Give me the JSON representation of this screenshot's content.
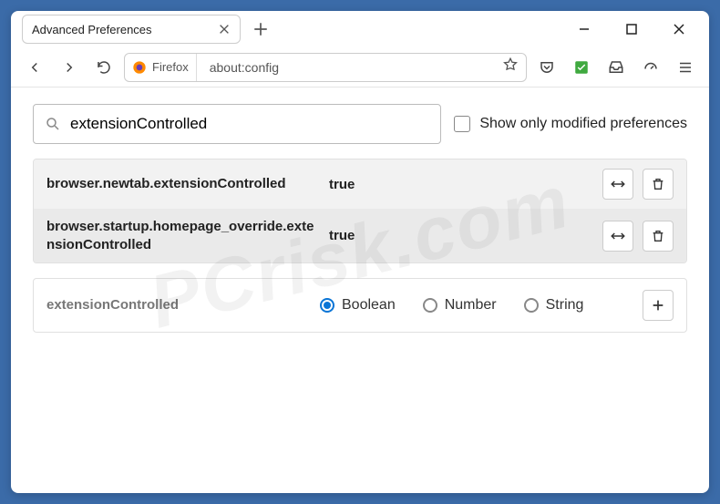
{
  "window": {
    "tab_title": "Advanced Preferences"
  },
  "urlbar": {
    "identity_label": "Firefox",
    "url": "about:config"
  },
  "config": {
    "search_value": "extensionControlled",
    "modified_only_label": "Show only modified preferences",
    "modified_only_checked": false
  },
  "prefs": [
    {
      "name": "browser.newtab.extensionControlled",
      "value": "true"
    },
    {
      "name": "browser.startup.homepage_override.extensionControlled",
      "value": "true"
    }
  ],
  "new_pref": {
    "name": "extensionControlled",
    "types": {
      "boolean": "Boolean",
      "number": "Number",
      "string": "String"
    },
    "selected": "boolean"
  }
}
